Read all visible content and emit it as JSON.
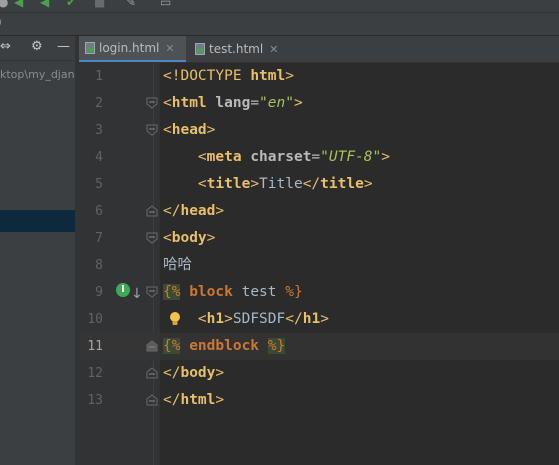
{
  "navigation": {
    "breadcrumb_tail": ")"
  },
  "project_panel": {
    "path_text": "ktop\\my_djan"
  },
  "tabs": [
    {
      "label": "login.html",
      "active": true
    },
    {
      "label": "test.html",
      "active": false
    }
  ],
  "editor": {
    "lines": [
      {
        "n": "1"
      },
      {
        "n": "2"
      },
      {
        "n": "3"
      },
      {
        "n": "4"
      },
      {
        "n": "5"
      },
      {
        "n": "6"
      },
      {
        "n": "7"
      },
      {
        "n": "8"
      },
      {
        "n": "9"
      },
      {
        "n": "10"
      },
      {
        "n": "11"
      },
      {
        "n": "12"
      },
      {
        "n": "13"
      }
    ],
    "tokens": {
      "doctype": "<!DOCTYPE",
      "html": "html",
      "lang": "lang",
      "en": "\"en\"",
      "head": "head",
      "meta": "meta",
      "charset": "charset",
      "utf8": "\"UTF-8\"",
      "title": "title",
      "title_text": "Title",
      "body": "body",
      "chinese_text": "哈哈",
      "tpl_open": "{%",
      "tpl_close": "%}",
      "block": "block",
      "block_name": "test",
      "h1": "h1",
      "h1_text": "SDFSDF",
      "endblock": "endblock"
    }
  },
  "colors": {
    "background": "#2b2b2b",
    "gutter": "#313335",
    "tag": "#e8bf6a",
    "string": "#a5c25c",
    "keyword": "#cc7832",
    "text": "#a9b7c6"
  }
}
